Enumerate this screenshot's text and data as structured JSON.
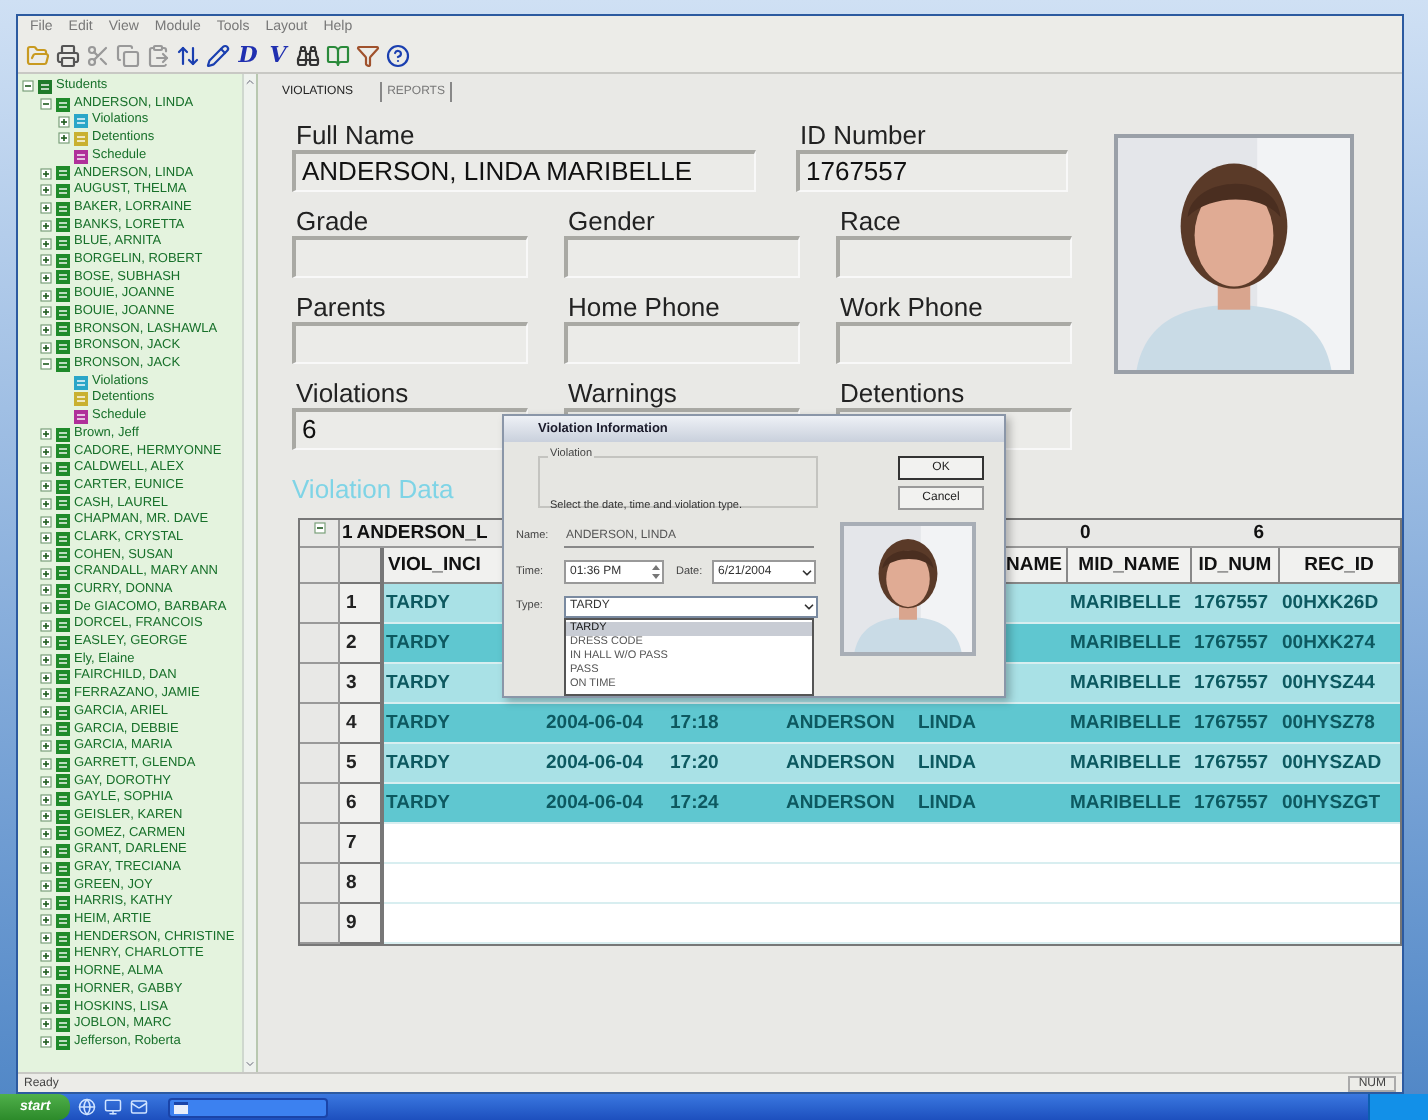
{
  "menu": [
    "File",
    "Edit",
    "View",
    "Module",
    "Tools",
    "Layout",
    "Help"
  ],
  "toolbar": [
    {
      "kind": "folder"
    },
    {
      "kind": "printer"
    },
    {
      "kind": "cut"
    },
    {
      "kind": "copy"
    },
    {
      "kind": "paste"
    },
    {
      "kind": "sort"
    },
    {
      "kind": "pencil"
    },
    {
      "kind": "letter",
      "label": "D"
    },
    {
      "kind": "letter",
      "label": "V"
    },
    {
      "kind": "binoculars"
    },
    {
      "kind": "book"
    },
    {
      "kind": "filter"
    },
    {
      "kind": "help"
    }
  ],
  "tree": [
    {
      "label": "Students",
      "kind": "folder",
      "expanded": true,
      "children": [
        {
          "label": "ANDERSON, LINDA",
          "kind": "student",
          "expanded": true,
          "children": [
            {
              "label": "Violations",
              "kind": "violations",
              "expanded": false
            },
            {
              "label": "Detentions",
              "kind": "detentions",
              "expanded": false
            },
            {
              "label": "Schedule",
              "kind": "schedule"
            }
          ]
        },
        {
          "label": "ANDERSON, LINDA",
          "kind": "student",
          "expanded": false
        },
        {
          "label": "AUGUST, THELMA",
          "kind": "student",
          "expanded": false
        },
        {
          "label": "BAKER, LORRAINE",
          "kind": "student",
          "expanded": false
        },
        {
          "label": "BANKS, LORETTA",
          "kind": "student",
          "expanded": false
        },
        {
          "label": "BLUE, ARNITA",
          "kind": "student",
          "expanded": false
        },
        {
          "label": "BORGELIN, ROBERT",
          "kind": "student",
          "expanded": false
        },
        {
          "label": "BOSE, SUBHASH",
          "kind": "student",
          "expanded": false
        },
        {
          "label": "BOUIE, JOANNE",
          "kind": "student",
          "expanded": false
        },
        {
          "label": "BOUIE, JOANNE",
          "kind": "student",
          "expanded": false
        },
        {
          "label": "BRONSON, LASHAWLA",
          "kind": "student",
          "expanded": false
        },
        {
          "label": "BRONSON, JACK",
          "kind": "student",
          "expanded": false
        },
        {
          "label": "BRONSON, JACK",
          "kind": "student",
          "expanded": true,
          "children": [
            {
              "label": "Violations",
              "kind": "violations"
            },
            {
              "label": "Detentions",
              "kind": "detentions"
            },
            {
              "label": "Schedule",
              "kind": "schedule"
            }
          ]
        },
        {
          "label": "Brown, Jeff",
          "kind": "student",
          "expanded": false
        },
        {
          "label": "CADORE, HERMYONNE",
          "kind": "student",
          "expanded": false
        },
        {
          "label": "CALDWELL, ALEX",
          "kind": "student",
          "expanded": false
        },
        {
          "label": "CARTER, EUNICE",
          "kind": "student",
          "expanded": false
        },
        {
          "label": "CASH, LAUREL",
          "kind": "student",
          "expanded": false
        },
        {
          "label": "CHAPMAN, MR. DAVE",
          "kind": "student",
          "expanded": false
        },
        {
          "label": "CLARK, CRYSTAL",
          "kind": "student",
          "expanded": false
        },
        {
          "label": "COHEN, SUSAN",
          "kind": "student",
          "expanded": false
        },
        {
          "label": "CRANDALL, MARY ANN",
          "kind": "student",
          "expanded": false
        },
        {
          "label": "CURRY, DONNA",
          "kind": "student",
          "expanded": false
        },
        {
          "label": "De GIACOMO, BARBARA",
          "kind": "student",
          "expanded": false
        },
        {
          "label": "DORCEL, FRANCOIS",
          "kind": "student",
          "expanded": false
        },
        {
          "label": "EASLEY, GEORGE",
          "kind": "student",
          "expanded": false
        },
        {
          "label": "Ely, Elaine",
          "kind": "student",
          "expanded": false
        },
        {
          "label": "FAIRCHILD, DAN",
          "kind": "student",
          "expanded": false
        },
        {
          "label": "FERRAZANO, JAMIE",
          "kind": "student",
          "expanded": false
        },
        {
          "label": "GARCIA, ARIEL",
          "kind": "student",
          "expanded": false
        },
        {
          "label": "GARCIA, DEBBIE",
          "kind": "student",
          "expanded": false
        },
        {
          "label": "GARCIA, MARIA",
          "kind": "student",
          "expanded": false
        },
        {
          "label": "GARRETT, GLENDA",
          "kind": "student",
          "expanded": false
        },
        {
          "label": "GAY, DOROTHY",
          "kind": "student",
          "expanded": false
        },
        {
          "label": "GAYLE, SOPHIA",
          "kind": "student",
          "expanded": false
        },
        {
          "label": "GEISLER, KAREN",
          "kind": "student",
          "expanded": false
        },
        {
          "label": "GOMEZ, CARMEN",
          "kind": "student",
          "expanded": false
        },
        {
          "label": "GRANT, DARLENE",
          "kind": "student",
          "expanded": false
        },
        {
          "label": "GRAY, TRECIANA",
          "kind": "student",
          "expanded": false
        },
        {
          "label": "GREEN, JOY",
          "kind": "student",
          "expanded": false
        },
        {
          "label": "HARRIS, KATHY",
          "kind": "student",
          "expanded": false
        },
        {
          "label": "HEIM, ARTIE",
          "kind": "student",
          "expanded": false
        },
        {
          "label": "HENDERSON, CHRISTINE",
          "kind": "student",
          "expanded": false
        },
        {
          "label": "HENRY, CHARLOTTE",
          "kind": "student",
          "expanded": false
        },
        {
          "label": "HORNE, ALMA",
          "kind": "student",
          "expanded": false
        },
        {
          "label": "HORNER, GABBY",
          "kind": "student",
          "expanded": false
        },
        {
          "label": "HOSKINS, LISA",
          "kind": "student",
          "expanded": false
        },
        {
          "label": "JOBLON, MARC",
          "kind": "student",
          "expanded": false
        },
        {
          "label": "Jefferson, Roberta",
          "kind": "student",
          "expanded": false
        }
      ]
    }
  ],
  "tabs": [
    {
      "label": "VIOLATIONS",
      "selected": true
    },
    {
      "label": "REPORTS",
      "selected": false
    }
  ],
  "form": [
    [
      {
        "label": "Full Name",
        "value": "ANDERSON, LINDA MARIBELLE"
      },
      {
        "label": "ID Number",
        "value": "1767557"
      }
    ],
    [
      {
        "label": "Grade"
      },
      {
        "label": "Gender"
      },
      {
        "label": "Race"
      }
    ],
    [
      {
        "label": "Parents"
      },
      {
        "label": "Home Phone"
      },
      {
        "label": "Work Phone"
      }
    ],
    [
      {
        "label": "Violations",
        "value": "6"
      },
      {
        "label": "Warnings"
      },
      {
        "label": "Detentions"
      }
    ]
  ],
  "photo": {
    "kind": "picture"
  },
  "section_title": "Violation Data",
  "table": {
    "group": {
      "index": "1",
      "name": "ANDERSON_L",
      "value_1": "0",
      "value_2": "6"
    },
    "headers": {
      "viol": "VIOL_INCI",
      "first": "NAME",
      "mid": "MID_NAME",
      "id": "ID_NUM",
      "rec": "REC_ID"
    },
    "rows": [
      {
        "num": "1",
        "viol": "TARDY",
        "mid": "MARIBELLE",
        "id": "1767557",
        "rec": "00HXK26D"
      },
      {
        "num": "2",
        "viol": "TARDY",
        "mid": "MARIBELLE",
        "id": "1767557",
        "rec": "00HXK274"
      },
      {
        "num": "3",
        "viol": "TARDY",
        "mid": "MARIBELLE",
        "id": "1767557",
        "rec": "00HYSZ44"
      },
      {
        "num": "4",
        "viol": "TARDY",
        "date": "2004-06-04",
        "time": "17:18",
        "last": "ANDERSON",
        "first": "LINDA",
        "mid": "MARIBELLE",
        "id": "1767557",
        "rec": "00HYSZ78"
      },
      {
        "num": "5",
        "viol": "TARDY",
        "date": "2004-06-04",
        "time": "17:20",
        "last": "ANDERSON",
        "first": "LINDA",
        "mid": "MARIBELLE",
        "id": "1767557",
        "rec": "00HYSZAD"
      },
      {
        "num": "6",
        "viol": "TARDY",
        "date": "2004-06-04",
        "time": "17:24",
        "last": "ANDERSON",
        "first": "LINDA",
        "mid": "MARIBELLE",
        "id": "1767557",
        "rec": "00HYSZGT"
      },
      {
        "num": "7"
      },
      {
        "num": "8"
      },
      {
        "num": "9"
      }
    ]
  },
  "dialog": {
    "title": "Violation Information",
    "group_label": "Violation",
    "instructions": "Select the date, time and violation type.",
    "buttons": [
      "OK",
      "Cancel"
    ],
    "name_label": "Name:",
    "name": "ANDERSON, LINDA",
    "time_label": "Time:",
    "time": "01:36 PM",
    "date_label": "Date:",
    "date": "6/21/2004",
    "type_label": "Type:",
    "type": "TARDY",
    "type_options": [
      {
        "label": "TARDY",
        "selected": true
      },
      {
        "label": "DRESS CODE",
        "selected": false
      },
      {
        "label": "IN HALL W/O PASS",
        "selected": false
      },
      {
        "label": "PASS",
        "selected": false
      },
      {
        "label": "ON TIME",
        "selected": false
      }
    ],
    "photo": {
      "kind": "picture"
    }
  },
  "status_bar": {
    "left": "Ready",
    "right": "NUM"
  },
  "taskbar": {
    "start": "start"
  }
}
